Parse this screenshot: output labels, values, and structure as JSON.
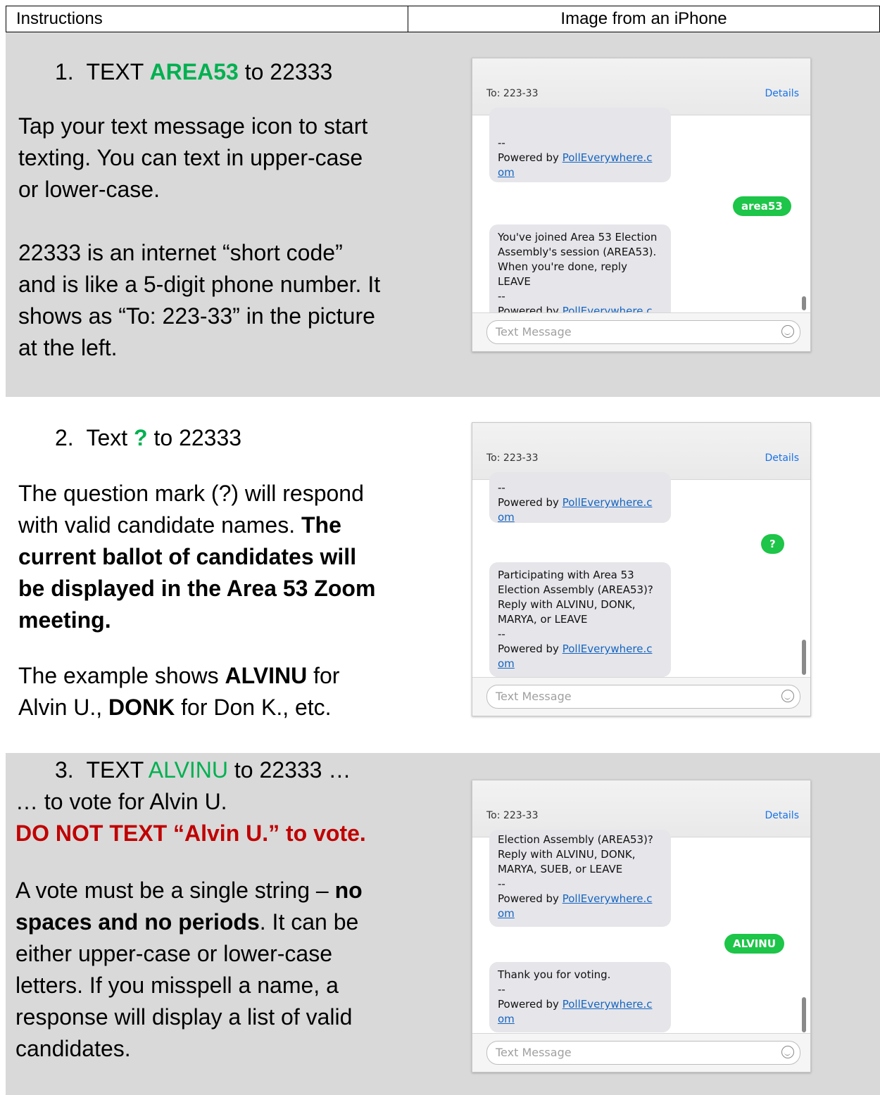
{
  "header": {
    "col1": "Instructions",
    "col2": "Image from an iPhone"
  },
  "step1": {
    "num": "1.",
    "pre": "TEXT ",
    "keyword": "AREA53",
    "post": " to 22333",
    "para1": "Tap your text message icon to start texting. You can text in upper-case or lower-case.",
    "para2": "22333 is an internet “short code” and is like a 5-digit phone number. It shows as “To: 223-33” in the picture at the left."
  },
  "step2": {
    "num": "2.",
    "pre": "Text ",
    "keyword": "?",
    "post": " to 22333",
    "para1_a": "The question mark (?) will respond with valid candidate names. ",
    "para1_b": "The current ballot of candidates will be displayed in the Area 53 Zoom meeting.",
    "para2_a": "The example shows ",
    "para2_b": "ALVINU",
    "para2_c": " for Alvin U., ",
    "para2_d": "DONK",
    "para2_e": " for Don K., etc."
  },
  "step3": {
    "num": "3.",
    "pre": "TEXT ",
    "keyword": "ALVINU",
    "post": " to 22333 …",
    "line2": "… to vote for Alvin U.",
    "warning": "DO NOT TEXT “Alvin U.” to vote.",
    "para_a": "A vote must be a single string – ",
    "para_b": "no spaces and no periods",
    "para_c": ".  It can be either upper-case or lower-case letters. If you misspell a name, a response will display a list of valid candidates."
  },
  "phone_common": {
    "to": "To:  223-33",
    "details": "Details",
    "dashes": "--",
    "powered": "Powered by ",
    "link1": "PollEverywhere.c",
    "link2": "om",
    "placeholder": "Text Message"
  },
  "phone1": {
    "sent": "area53",
    "reply": "You've joined Area 53 Election Assembly's session (AREA53). When you're done, reply LEAVE"
  },
  "phone2": {
    "sent": "?",
    "reply": "Participating with Area 53 Election Assembly (AREA53)? Reply with ALVINU, DONK, MARYA, or LEAVE"
  },
  "phone3": {
    "top_text": "Election Assembly (AREA53)? Reply with ALVINU, DONK, MARYA, SUEB, or LEAVE",
    "sent": "ALVINU",
    "reply": "Thank you for voting."
  }
}
